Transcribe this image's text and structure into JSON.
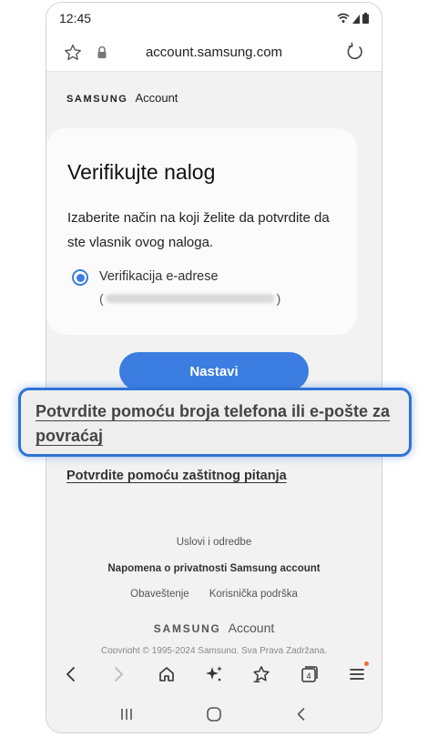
{
  "status_bar": {
    "time": "12:45"
  },
  "browser": {
    "url": "account.samsung.com"
  },
  "header": {
    "brand_wordmark": "SAMSUNG",
    "brand_product": "Account"
  },
  "card": {
    "title": "Verifikujte nalog",
    "description": "Izaberite način na koji želite da potvrdite da ste vlasnik ovog naloga.",
    "option_label": "Verifikacija e-adrese",
    "option_open_paren": "(",
    "option_close_paren": ")"
  },
  "actions": {
    "continue_label": "Nastavi",
    "recovery_link": "Potvrdite pomoću broja telefona ili e-pošte za povraćaj",
    "security_link": "Potvrdite pomoću zaštitnog pitanja"
  },
  "footer": {
    "terms": "Uslovi i odredbe",
    "privacy": "Napomena o privatnosti Samsung account",
    "notice": "Obaveštenje",
    "support": "Korisnička podrška",
    "brand_wordmark": "SAMSUNG",
    "brand_product": "Account",
    "copyright": "Copyright © 1995-2024 Samsung. Sva Prava Zadržana."
  },
  "toolbar": {
    "tabs_count": "4"
  },
  "colors": {
    "accent": "#3b7de0",
    "highlight": "#2f73d6",
    "notification": "#f46b2c"
  },
  "icons": [
    "star-icon",
    "lock-icon",
    "reload-icon",
    "back-icon",
    "forward-icon",
    "home-icon",
    "sparkle-icon",
    "bookmark-star-icon",
    "tabs-icon",
    "menu-icon",
    "recents-icon",
    "home-circle-icon",
    "nav-back-icon",
    "wifi-icon",
    "signal-icon",
    "battery-icon"
  ]
}
